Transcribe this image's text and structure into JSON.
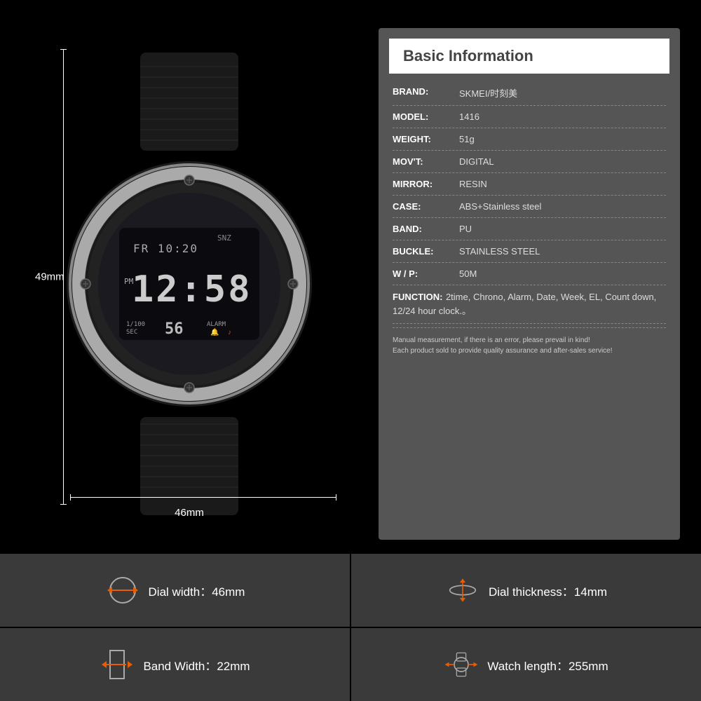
{
  "page": {
    "background": "#000000"
  },
  "dimensions": {
    "height_label": "49mm",
    "width_label": "46mm"
  },
  "info_panel": {
    "title": "Basic Information",
    "rows": [
      {
        "key": "BRAND:",
        "value": "SKMEI/时刻美"
      },
      {
        "key": "MODEL:",
        "value": "1416"
      },
      {
        "key": "WEIGHT:",
        "value": "51g"
      },
      {
        "key": "MOV'T:",
        "value": "DIGITAL"
      },
      {
        "key": "MIRROR:",
        "value": "RESIN"
      },
      {
        "key": "CASE:",
        "value": "ABS+Stainless steel"
      },
      {
        "key": "BAND:",
        "value": "PU"
      },
      {
        "key": "BUCKLE:",
        "value": "STAINLESS STEEL"
      },
      {
        "key": "W / P:",
        "value": "50M"
      }
    ],
    "function_key": "FUNCTION:",
    "function_value": "2time, Chrono, Alarm, Date, Week, EL, Count down, 12/24 hour clock.。",
    "note_line1": "Manual measurement, if there is an error, please prevail in kind!",
    "note_line2": "Each product sold to provide quality assurance and after-sales service!"
  },
  "specs": [
    {
      "icon": "dial-width-icon",
      "label": "Dial width：46mm"
    },
    {
      "icon": "dial-thickness-icon",
      "label": "Dial thickness：14mm"
    },
    {
      "icon": "band-width-icon",
      "label": "Band Width：22mm"
    },
    {
      "icon": "watch-length-icon",
      "label": "Watch length：255mm"
    }
  ]
}
